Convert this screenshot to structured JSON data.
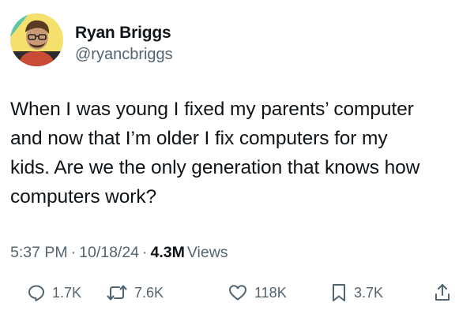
{
  "author": {
    "name": "Ryan Briggs",
    "handle": "@ryancbriggs",
    "avatar_colors": {
      "bg": "#f5e06e",
      "shirt": "#c94b36",
      "skin": "#c99a75",
      "hair": "#5a3a22",
      "accent": "#5bc7a8"
    }
  },
  "tweet": {
    "lines": [
      "When I was young I fixed my parents’ computer",
      "and now that I’m older I fix computers for my",
      "kids. Are we the only generation that knows how",
      "computers work?"
    ]
  },
  "meta": {
    "time": "5:37 PM",
    "date": "10/18/24",
    "separator": "·",
    "views_count": "4.3M",
    "views_label": "Views"
  },
  "actions": {
    "replies": "1.7K",
    "reposts": "7.6K",
    "likes": "118K",
    "bookmarks": "3.7K"
  },
  "icons": [
    "reply-icon",
    "repost-icon",
    "like-icon",
    "bookmark-icon",
    "share-icon"
  ],
  "colors": {
    "text": "#0f1419",
    "secondary": "#536471"
  }
}
